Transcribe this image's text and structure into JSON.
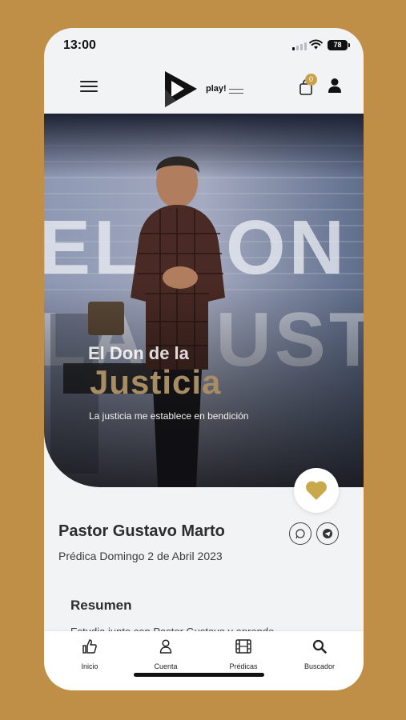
{
  "status_bar": {
    "time": "13:00",
    "battery": "78"
  },
  "header": {
    "logo_text": "play!",
    "cart_count": "0",
    "menu_icon": "hamburger-menu-icon",
    "cart_icon": "shopping-bag-icon",
    "user_icon": "user-icon"
  },
  "hero": {
    "title_line1": "El Don de la",
    "title_line2": "Justicia",
    "subtitle": "La justicia me establece en bendición",
    "background_text": "EL DON DE LA JUSTICIA",
    "accent_color": "#a88c64"
  },
  "sermon": {
    "pastor": "Pastor Gustavo Marto",
    "date": "Prédica Domingo 2 de Abril 2023",
    "summary_heading": "Resumen",
    "summary_preview": "Estudia junto con Pastor Gustavo y aprende"
  },
  "actions": {
    "favorite_icon": "heart-icon",
    "whatsapp_icon": "whatsapp-icon",
    "telegram_icon": "telegram-icon"
  },
  "bottom_nav": [
    {
      "label": "Inicio",
      "icon": "thumbs-up-icon"
    },
    {
      "label": "Cuenta",
      "icon": "user-outline-icon"
    },
    {
      "label": "Prédicas",
      "icon": "film-icon"
    },
    {
      "label": "Buscador",
      "icon": "search-icon"
    }
  ],
  "colors": {
    "background": "#c08f47",
    "accent": "#c9a14a"
  }
}
